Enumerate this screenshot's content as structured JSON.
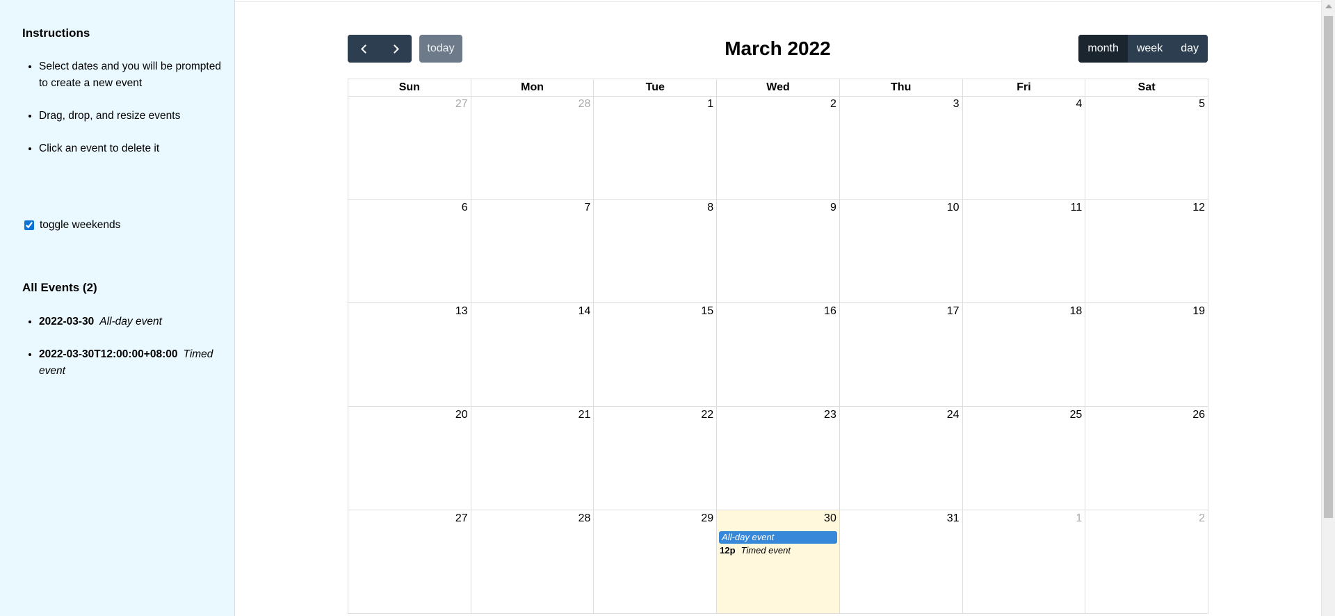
{
  "sidebar": {
    "instructions_title": "Instructions",
    "instructions": [
      "Select dates and you will be prompted to create a new event",
      "Drag, drop, and resize events",
      "Click an event to delete it"
    ],
    "toggle_weekends_label": "toggle weekends",
    "toggle_weekends_checked": true,
    "events_title": "All Events (2)",
    "events": [
      {
        "date": "2022-03-30",
        "title": "All-day event"
      },
      {
        "date": "2022-03-30T12:00:00+08:00",
        "title": "Timed event"
      }
    ]
  },
  "calendar": {
    "title": "March 2022",
    "today_label": "today",
    "prev_icon": "chevron-left-icon",
    "next_icon": "chevron-right-icon",
    "views": [
      {
        "label": "month",
        "active": true
      },
      {
        "label": "week",
        "active": false
      },
      {
        "label": "day",
        "active": false
      }
    ],
    "weekdays": [
      "Sun",
      "Mon",
      "Tue",
      "Wed",
      "Thu",
      "Fri",
      "Sat"
    ],
    "weeks": [
      [
        {
          "day": "27",
          "other": true
        },
        {
          "day": "28",
          "other": true
        },
        {
          "day": "1"
        },
        {
          "day": "2"
        },
        {
          "day": "3"
        },
        {
          "day": "4"
        },
        {
          "day": "5"
        }
      ],
      [
        {
          "day": "6"
        },
        {
          "day": "7"
        },
        {
          "day": "8"
        },
        {
          "day": "9"
        },
        {
          "day": "10"
        },
        {
          "day": "11"
        },
        {
          "day": "12"
        }
      ],
      [
        {
          "day": "13"
        },
        {
          "day": "14"
        },
        {
          "day": "15"
        },
        {
          "day": "16"
        },
        {
          "day": "17"
        },
        {
          "day": "18"
        },
        {
          "day": "19"
        }
      ],
      [
        {
          "day": "20"
        },
        {
          "day": "21"
        },
        {
          "day": "22"
        },
        {
          "day": "23"
        },
        {
          "day": "24"
        },
        {
          "day": "25"
        },
        {
          "day": "26"
        }
      ],
      [
        {
          "day": "27"
        },
        {
          "day": "28"
        },
        {
          "day": "29"
        },
        {
          "day": "30",
          "today": true,
          "events": [
            {
              "kind": "allday",
              "title": "All-day event"
            },
            {
              "kind": "timed",
              "time": "12p",
              "title": "Timed event"
            }
          ]
        },
        {
          "day": "31"
        },
        {
          "day": "1",
          "other": true
        },
        {
          "day": "2",
          "other": true
        }
      ]
    ]
  },
  "colors": {
    "sidebar_bg": "#eaf9ff",
    "button_bg": "#2c3e50",
    "button_active_bg": "#1a252f",
    "today_button_bg": "#6c7a89",
    "today_cell_bg": "#fff8dc",
    "event_bg": "#3788d8"
  }
}
